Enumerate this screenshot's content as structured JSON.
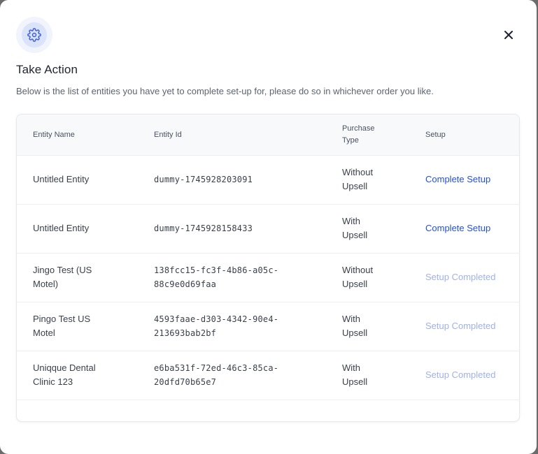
{
  "modal": {
    "title": "Take Action",
    "subtitle": "Below is the list of entities you have yet to complete set-up for, please do so in whichever order you like.",
    "header_icon": "gear-icon",
    "close_icon": "close-icon"
  },
  "table": {
    "headers": {
      "name": "Entity Name",
      "id": "Entity Id",
      "type": "Purchase Type",
      "setup": "Setup"
    },
    "rows": [
      {
        "name": "Untitled Entity",
        "id": "dummy-1745928203091",
        "type": "Without Upsell",
        "setup": "Complete Setup",
        "status": "pending"
      },
      {
        "name": "Untitled Entity",
        "id": "dummy-1745928158433",
        "type": "With Upsell",
        "setup": "Complete Setup",
        "status": "pending"
      },
      {
        "name": "Jingo Test (US Motel)",
        "id": "138fcc15-fc3f-4b86-a05c-88c9e0d69faa",
        "type": "Without Upsell",
        "setup": "Setup Completed",
        "status": "done"
      },
      {
        "name": "Pingo Test US Motel",
        "id": "4593faae-d303-4342-90e4-213693bab2bf",
        "type": "With Upsell",
        "setup": "Setup Completed",
        "status": "done"
      },
      {
        "name": "Uniqque Dental Clinic 123",
        "id": "e6ba531f-72ed-46c3-85ca-20dfd70b65e7",
        "type": "With Upsell",
        "setup": "Setup Completed",
        "status": "done"
      }
    ]
  },
  "colors": {
    "accent": "#2350d8",
    "completed": "#9fb1e8",
    "overlay": "#6b6b6b"
  }
}
